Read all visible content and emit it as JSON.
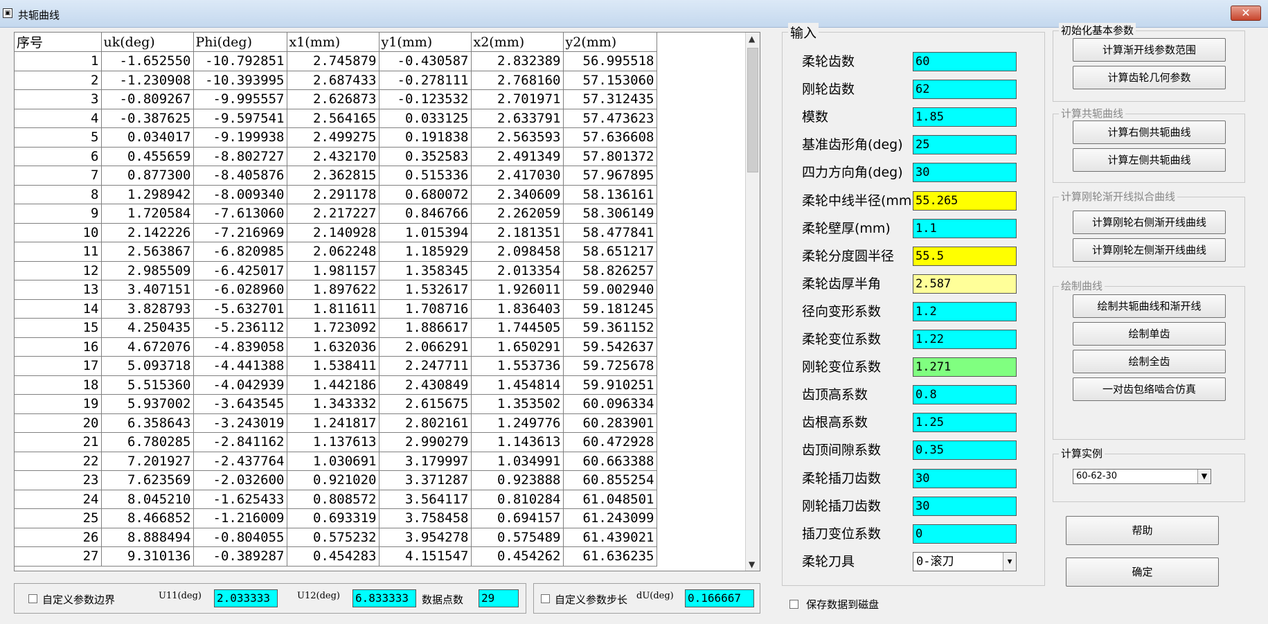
{
  "window": {
    "title": "共轭曲线",
    "close_glyph": "✕"
  },
  "table": {
    "headers": [
      "序号",
      "uk(deg)",
      "Phi(deg)",
      "x1(mm)",
      "y1(mm)",
      "x2(mm)",
      "y2(mm)"
    ],
    "rows": [
      [
        "1",
        "-1.652550",
        "-10.792851",
        "2.745879",
        "-0.430587",
        "2.832389",
        "56.995518"
      ],
      [
        "2",
        "-1.230908",
        "-10.393995",
        "2.687433",
        "-0.278111",
        "2.768160",
        "57.153060"
      ],
      [
        "3",
        "-0.809267",
        "-9.995557",
        "2.626873",
        "-0.123532",
        "2.701971",
        "57.312435"
      ],
      [
        "4",
        "-0.387625",
        "-9.597541",
        "2.564165",
        "0.033125",
        "2.633791",
        "57.473623"
      ],
      [
        "5",
        "0.034017",
        "-9.199938",
        "2.499275",
        "0.191838",
        "2.563593",
        "57.636608"
      ],
      [
        "6",
        "0.455659",
        "-8.802727",
        "2.432170",
        "0.352583",
        "2.491349",
        "57.801372"
      ],
      [
        "7",
        "0.877300",
        "-8.405876",
        "2.362815",
        "0.515336",
        "2.417030",
        "57.967895"
      ],
      [
        "8",
        "1.298942",
        "-8.009340",
        "2.291178",
        "0.680072",
        "2.340609",
        "58.136161"
      ],
      [
        "9",
        "1.720584",
        "-7.613060",
        "2.217227",
        "0.846766",
        "2.262059",
        "58.306149"
      ],
      [
        "10",
        "2.142226",
        "-7.216969",
        "2.140928",
        "1.015394",
        "2.181351",
        "58.477841"
      ],
      [
        "11",
        "2.563867",
        "-6.820985",
        "2.062248",
        "1.185929",
        "2.098458",
        "58.651217"
      ],
      [
        "12",
        "2.985509",
        "-6.425017",
        "1.981157",
        "1.358345",
        "2.013354",
        "58.826257"
      ],
      [
        "13",
        "3.407151",
        "-6.028960",
        "1.897622",
        "1.532617",
        "1.926011",
        "59.002940"
      ],
      [
        "14",
        "3.828793",
        "-5.632701",
        "1.811611",
        "1.708716",
        "1.836403",
        "59.181245"
      ],
      [
        "15",
        "4.250435",
        "-5.236112",
        "1.723092",
        "1.886617",
        "1.744505",
        "59.361152"
      ],
      [
        "16",
        "4.672076",
        "-4.839058",
        "1.632036",
        "2.066291",
        "1.650291",
        "59.542637"
      ],
      [
        "17",
        "5.093718",
        "-4.441388",
        "1.538411",
        "2.247711",
        "1.553736",
        "59.725678"
      ],
      [
        "18",
        "5.515360",
        "-4.042939",
        "1.442186",
        "2.430849",
        "1.454814",
        "59.910251"
      ],
      [
        "19",
        "5.937002",
        "-3.643545",
        "1.343332",
        "2.615675",
        "1.353502",
        "60.096334"
      ],
      [
        "20",
        "6.358643",
        "-3.243019",
        "1.241817",
        "2.802161",
        "1.249776",
        "60.283901"
      ],
      [
        "21",
        "6.780285",
        "-2.841162",
        "1.137613",
        "2.990279",
        "1.143613",
        "60.472928"
      ],
      [
        "22",
        "7.201927",
        "-2.437764",
        "1.030691",
        "3.179997",
        "1.034991",
        "60.663388"
      ],
      [
        "23",
        "7.623569",
        "-2.032600",
        "0.921020",
        "3.371287",
        "0.923888",
        "60.855254"
      ],
      [
        "24",
        "8.045210",
        "-1.625433",
        "0.808572",
        "3.564117",
        "0.810284",
        "61.048501"
      ],
      [
        "25",
        "8.466852",
        "-1.216009",
        "0.693319",
        "3.758458",
        "0.694157",
        "61.243099"
      ],
      [
        "26",
        "8.888494",
        "-0.804055",
        "0.575232",
        "3.954278",
        "0.575489",
        "61.439021"
      ],
      [
        "27",
        "9.310136",
        "-0.389287",
        "0.454283",
        "4.151547",
        "0.454262",
        "61.636235"
      ]
    ]
  },
  "bottom": {
    "custom_bounds_label": "自定义参数边界",
    "u11_label": "U11(deg)",
    "u11_value": "2.033333",
    "u12_label": "U12(deg)",
    "u12_value": "6.833333",
    "points_label": "数据点数",
    "points_value": "29",
    "custom_step_label": "自定义参数步长",
    "du_label": "dU(deg)",
    "du_value": "0.166667",
    "save_label": "保存数据到磁盘"
  },
  "input": {
    "group_label": "输入",
    "fields": [
      {
        "label": "柔轮齿数",
        "value": "60",
        "color": "#00ffff"
      },
      {
        "label": "刚轮齿数",
        "value": "62",
        "color": "#00ffff"
      },
      {
        "label": "模数",
        "value": "1.85",
        "color": "#00ffff"
      },
      {
        "label": "基准齿形角(deg)",
        "value": "25",
        "color": "#00ffff"
      },
      {
        "label": "四力方向角(deg)",
        "value": "30",
        "color": "#00ffff"
      },
      {
        "label": "柔轮中线半径(mm)",
        "value": "55.265",
        "color": "#ffff00"
      },
      {
        "label": "柔轮壁厚(mm)",
        "value": "1.1",
        "color": "#00ffff"
      },
      {
        "label": "柔轮分度圆半径",
        "value": "55.5",
        "color": "#ffff00"
      },
      {
        "label": "柔轮齿厚半角",
        "value": "2.587",
        "color": "#ffff99"
      },
      {
        "label": "径向变形系数",
        "value": "1.2",
        "color": "#00ffff"
      },
      {
        "label": "柔轮变位系数",
        "value": "1.22",
        "color": "#00ffff"
      },
      {
        "label": "刚轮变位系数",
        "value": "1.271",
        "color": "#80ff80"
      },
      {
        "label": "齿顶高系数",
        "value": "0.8",
        "color": "#00ffff"
      },
      {
        "label": "齿根高系数",
        "value": "1.25",
        "color": "#00ffff"
      },
      {
        "label": "齿顶间隙系数",
        "value": "0.35",
        "color": "#00ffff"
      },
      {
        "label": "柔轮插刀齿数",
        "value": "30",
        "color": "#00ffff"
      },
      {
        "label": "刚轮插刀齿数",
        "value": "30",
        "color": "#00ffff"
      },
      {
        "label": "插刀变位系数",
        "value": "0",
        "color": "#00ffff"
      }
    ],
    "tool_label": "柔轮刀具",
    "tool_value": "0-滚刀"
  },
  "groups": {
    "init": {
      "label": "初始化基本参数",
      "buttons": [
        "计算渐开线参数范围",
        "计算齿轮几何参数"
      ]
    },
    "conj": {
      "label": "计算共轭曲线",
      "buttons": [
        "计算右侧共轭曲线",
        "计算左侧共轭曲线"
      ]
    },
    "fit": {
      "label": "计算刚轮渐开线拟合曲线",
      "buttons": [
        "计算刚轮右侧渐开线曲线",
        "计算刚轮左侧渐开线曲线"
      ]
    },
    "draw": {
      "label": "绘制曲线",
      "buttons": [
        "绘制共轭曲线和渐开线",
        "绘制单齿",
        "绘制全齿",
        "一对齿包络啮合仿真"
      ]
    },
    "example": {
      "label": "计算实例",
      "value": "60-62-30"
    }
  },
  "buttons": {
    "help": "帮助",
    "ok": "确定"
  }
}
